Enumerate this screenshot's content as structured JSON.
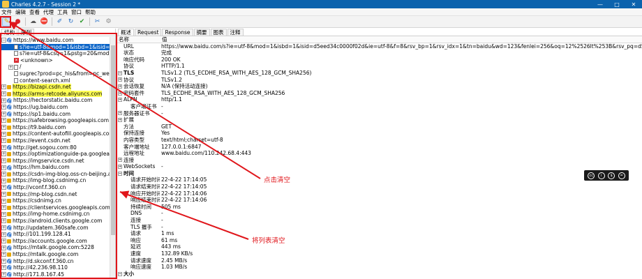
{
  "window": {
    "title": "Charles 4.2.7 - Session 2 *",
    "buttons": [
      "—",
      "□",
      "✕"
    ]
  },
  "menu": [
    "文件",
    "编辑",
    "查看",
    "代理",
    "工具",
    "窗口",
    "帮助"
  ],
  "toolbar": {
    "icons": [
      "broom-icon",
      "record-icon",
      "throttle-icon",
      "breakpoint-icon",
      "pen-icon",
      "refresh-icon",
      "check-icon",
      "tools-icon",
      "settings-icon"
    ],
    "glyphs": [
      "✎",
      "●",
      "☁",
      "⛔",
      "✐",
      "↻",
      "✔",
      "✂",
      "⚙"
    ],
    "colors": [
      "#e6a800",
      "#d8252b",
      "#555555",
      "#d8252b",
      "#2a72c8",
      "#2a72c8",
      "#2e9a2e",
      "#2a72c8",
      "#8a8a8a"
    ]
  },
  "left_tabs": [
    "结构",
    "序列"
  ],
  "tree": [
    {
      "exp": "-",
      "icon": "globe",
      "text": "https://www.baidu.com",
      "level": 0
    },
    {
      "exp": "",
      "icon": "doc",
      "text": "s?ie=utf-8&mod=1&isbd=1&isid=d5ee",
      "level": 1,
      "selected": true
    },
    {
      "exp": "",
      "icon": "doc",
      "text": "s?ie=utf-8&csq=1&pstg=20&mod=2&i",
      "level": 1
    },
    {
      "exp": "",
      "icon": "err",
      "text": "<unknown>",
      "level": 1
    },
    {
      "exp": "+",
      "icon": "doc",
      "text": "/",
      "level": 1
    },
    {
      "exp": "",
      "icon": "doc",
      "text": "sugrec?prod=pc_his&from=pc_web&jsc",
      "level": 1
    },
    {
      "exp": "",
      "icon": "doc",
      "text": "content-search.xml",
      "level": 1
    },
    {
      "exp": "+",
      "icon": "lock",
      "text": "https://bizapi.csdn.net",
      "level": 0,
      "highlight": true
    },
    {
      "exp": "+",
      "icon": "lock",
      "text": "https://arms-retcode.aliyuncs.com",
      "level": 0,
      "highlight": true
    },
    {
      "exp": "+",
      "icon": "globe",
      "text": "https://hectorstatic.baidu.com",
      "level": 0
    },
    {
      "exp": "+",
      "icon": "globe",
      "text": "https://ug.baidu.com",
      "level": 0
    },
    {
      "exp": "+",
      "icon": "globe",
      "text": "https://sp1.baidu.com",
      "level": 0
    },
    {
      "exp": "+",
      "icon": "lock",
      "text": "https://safebrowsing.googleapis.com",
      "level": 0
    },
    {
      "exp": "+",
      "icon": "lock",
      "text": "https://t9.baidu.com",
      "level": 0
    },
    {
      "exp": "+",
      "icon": "lock",
      "text": "https://content-autofill.googleapis.com",
      "level": 0
    },
    {
      "exp": "+",
      "icon": "lock",
      "text": "https://event.csdn.net",
      "level": 0
    },
    {
      "exp": "+",
      "icon": "globe",
      "text": "http://get.sogou.com:80",
      "level": 0
    },
    {
      "exp": "+",
      "icon": "lock",
      "text": "https://optimizationguide-pa.googleapis.co",
      "level": 0
    },
    {
      "exp": "+",
      "icon": "lock",
      "text": "https://imgservice.csdn.net",
      "level": 0
    },
    {
      "exp": "+",
      "icon": "globe",
      "text": "https://hm.baidu.com",
      "level": 0
    },
    {
      "exp": "+",
      "icon": "lock",
      "text": "https://csdn-img-blog.oss-cn-beijing.aliyu",
      "level": 0
    },
    {
      "exp": "+",
      "icon": "lock",
      "text": "https://img-blog.csdnimg.cn",
      "level": 0
    },
    {
      "exp": "+",
      "icon": "globe",
      "text": "http://vconf.f.360.cn",
      "level": 0
    },
    {
      "exp": "+",
      "icon": "lock",
      "text": "https://mp-blog.csdn.net",
      "level": 0
    },
    {
      "exp": "+",
      "icon": "lock",
      "text": "https://csdnimg.cn",
      "level": 0
    },
    {
      "exp": "+",
      "icon": "lock",
      "text": "https://clientservices.googleapis.com",
      "level": 0
    },
    {
      "exp": "+",
      "icon": "lock",
      "text": "https://img-home.csdnimg.cn",
      "level": 0
    },
    {
      "exp": "+",
      "icon": "lock",
      "text": "https://android.clients.google.com",
      "level": 0
    },
    {
      "exp": "+",
      "icon": "globe",
      "text": "http://updatem.360safe.com",
      "level": 0
    },
    {
      "exp": "+",
      "icon": "globe",
      "text": "http://101.199.128.41",
      "level": 0
    },
    {
      "exp": "+",
      "icon": "lock",
      "text": "https://accounts.google.com",
      "level": 0
    },
    {
      "exp": "+",
      "icon": "globe",
      "text": "https://mtalk.google.com:5228",
      "level": 0
    },
    {
      "exp": "+",
      "icon": "lock",
      "text": "https://mtalk.google.com",
      "level": 0
    },
    {
      "exp": "+",
      "icon": "globe",
      "text": "http://d.skconf.f.360.cn",
      "level": 0
    },
    {
      "exp": "+",
      "icon": "globe",
      "text": "http://42.236.98.110",
      "level": 0
    },
    {
      "exp": "+",
      "icon": "globe",
      "text": "http://171.8.167.45",
      "level": 0
    }
  ],
  "right_tabs": [
    "概述",
    "Request",
    "Response",
    "摘要",
    "图表",
    "注释"
  ],
  "detail_head": [
    "名称",
    "值"
  ],
  "details": [
    {
      "k": "URL",
      "v": "https://www.baidu.com/s?ie=utf-8&mod=1&isbd=1&isid=d5eed34c0000f02d&ie=utf-8&f=8&rsv_bp=1&rsv_idx=1&tn=baidu&wd=123&fenlei=256&oq=12%2526lt%253B&rsv_pq=d5eed34c0000f02d&rsv_t=520…",
      "lvl": 1
    },
    {
      "k": "状态",
      "v": "完成",
      "lvl": 1
    },
    {
      "k": "响应代码",
      "v": "200 OK",
      "lvl": 1
    },
    {
      "k": "协议",
      "v": "HTTP/1.1",
      "lvl": 1
    },
    {
      "k": "TLS",
      "v": "TLSv1.2 (TLS_ECDHE_RSA_WITH_AES_128_GCM_SHA256)",
      "lvl": 0,
      "exp": "-",
      "bold": true
    },
    {
      "k": "协议",
      "v": "TLSv1.2",
      "lvl": 1,
      "exp": "+"
    },
    {
      "k": "会话恢复",
      "v": "N/A (保持活动连接)",
      "lvl": 1,
      "exp": "+"
    },
    {
      "k": "密码套件",
      "v": "TLS_ECDHE_RSA_WITH_AES_128_GCM_SHA256",
      "lvl": 1,
      "exp": "+"
    },
    {
      "k": "ALPN",
      "v": "http/1.1",
      "lvl": 1,
      "exp": "+"
    },
    {
      "k": "客户端证书",
      "v": "-",
      "lvl": 2
    },
    {
      "k": "服务器证书",
      "v": "-",
      "lvl": 1,
      "exp": "+"
    },
    {
      "k": "扩展",
      "v": "",
      "lvl": 1,
      "exp": "+"
    },
    {
      "k": "方法",
      "v": "GET",
      "lvl": 1
    },
    {
      "k": "保持连接",
      "v": "Yes",
      "lvl": 1
    },
    {
      "k": "内容类型",
      "v": "text/html;charset=utf-8",
      "lvl": 1
    },
    {
      "k": "客户端地址",
      "v": "127.0.0.1:6847",
      "lvl": 1
    },
    {
      "k": "远程地址",
      "v": "www.baidu.com/110.242.68.4:443",
      "lvl": 1
    },
    {
      "k": "连接",
      "v": "",
      "lvl": 0,
      "exp": "+"
    },
    {
      "k": "WebSockets",
      "v": "-",
      "lvl": 0,
      "exp": "+"
    },
    {
      "k": "时间",
      "v": "",
      "lvl": 0,
      "exp": "-",
      "bold": true
    },
    {
      "k": "请求开始时间",
      "v": "22-4-22 17:14:05",
      "lvl": 2
    },
    {
      "k": "请求结束时间",
      "v": "22-4-22 17:14:05",
      "lvl": 2
    },
    {
      "k": "响应开始时间",
      "v": "22-4-22 17:14:06",
      "lvl": 2
    },
    {
      "k": "响应结束时间",
      "v": "22-4-22 17:14:06",
      "lvl": 2
    },
    {
      "k": "持续时间",
      "v": "505 ms",
      "lvl": 2
    },
    {
      "k": "DNS",
      "v": "-",
      "lvl": 2
    },
    {
      "k": "连接",
      "v": "-",
      "lvl": 2
    },
    {
      "k": "TLS 握手",
      "v": "-",
      "lvl": 2
    },
    {
      "k": "请求",
      "v": "1 ms",
      "lvl": 2
    },
    {
      "k": "响应",
      "v": "61 ms",
      "lvl": 2
    },
    {
      "k": "延迟",
      "v": "443 ms",
      "lvl": 2
    },
    {
      "k": "速度",
      "v": "132.89 KB/s",
      "lvl": 2
    },
    {
      "k": "请求速度",
      "v": "2.45 MB/s",
      "lvl": 2
    },
    {
      "k": "响应速度",
      "v": "1.03 MB/s",
      "lvl": 2
    },
    {
      "k": "大小",
      "v": "",
      "lvl": 0,
      "exp": "-",
      "bold": true
    }
  ],
  "cc_badge": [
    "cc",
    "i",
    "$",
    "="
  ],
  "annotations": {
    "top_label": "点击清空",
    "bottom_label": "将列表清空",
    "color": "#e0161b"
  }
}
